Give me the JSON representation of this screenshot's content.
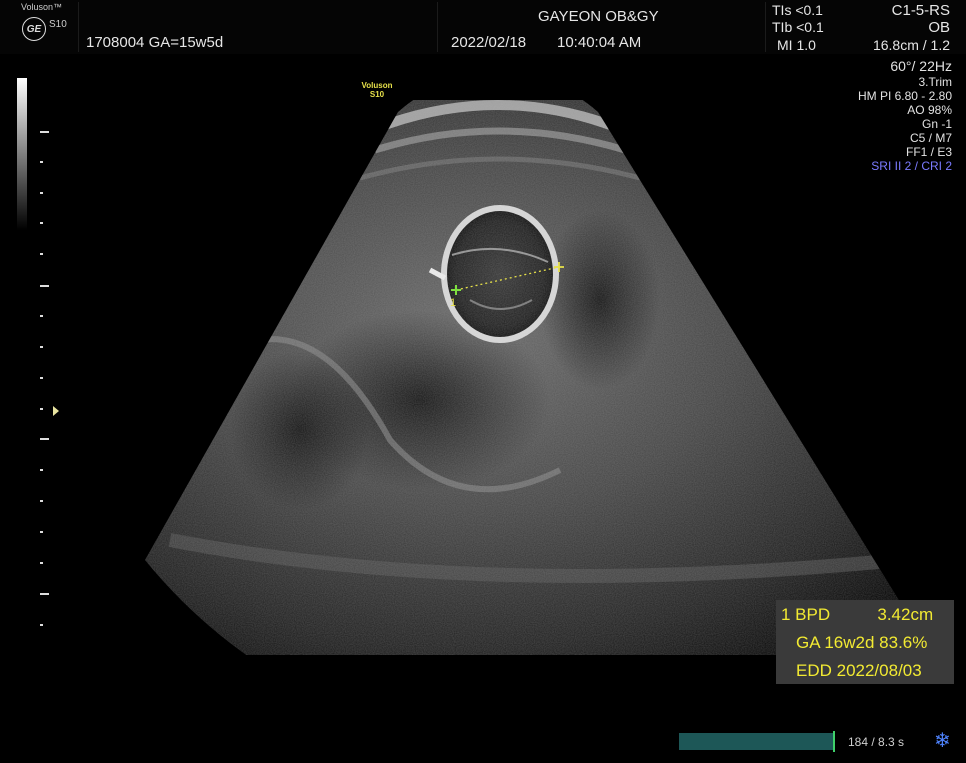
{
  "header": {
    "brand": "Voluson™",
    "ge_logo": "GE",
    "model": "S10",
    "patient_line": "1708004  GA=15w5d",
    "institution": "GAYEON OB&GY",
    "date": "2022/02/18",
    "time": "10:40:04 AM",
    "tis": "TIs <0.1",
    "tib": "TIb <0.1",
    "mi": "MI  1.0",
    "probe": "C1-5-RS",
    "application": "OB",
    "depth_scale": "16.8cm / 1.2"
  },
  "params": [
    "60°/ 22Hz",
    "3.Trim",
    "HM PI 6.80 - 2.80",
    "AO 98%",
    "Gn  -1",
    "C5 / M7",
    "FF1 / E3",
    "SRI II 2 / CRI 2"
  ],
  "image_watermark": {
    "brand": "Voluson",
    "model": "S10"
  },
  "caliper": {
    "label": "1"
  },
  "measurements": {
    "line1": "1 BPD          3.42cm",
    "line2": "GA 16w2d 83.6%",
    "line3": "EDD  2022/08/03"
  },
  "cine": {
    "status": "184 / 8.3 s",
    "progress": 1.0
  },
  "icons": {
    "freeze": "snowflake-icon",
    "focus": "focus-marker-icon"
  },
  "colors": {
    "measurement_text": "#f2ea32",
    "caliper": "#7fe040",
    "highlight_param": "#7b7bff",
    "cine_bar": "#1d5757"
  }
}
